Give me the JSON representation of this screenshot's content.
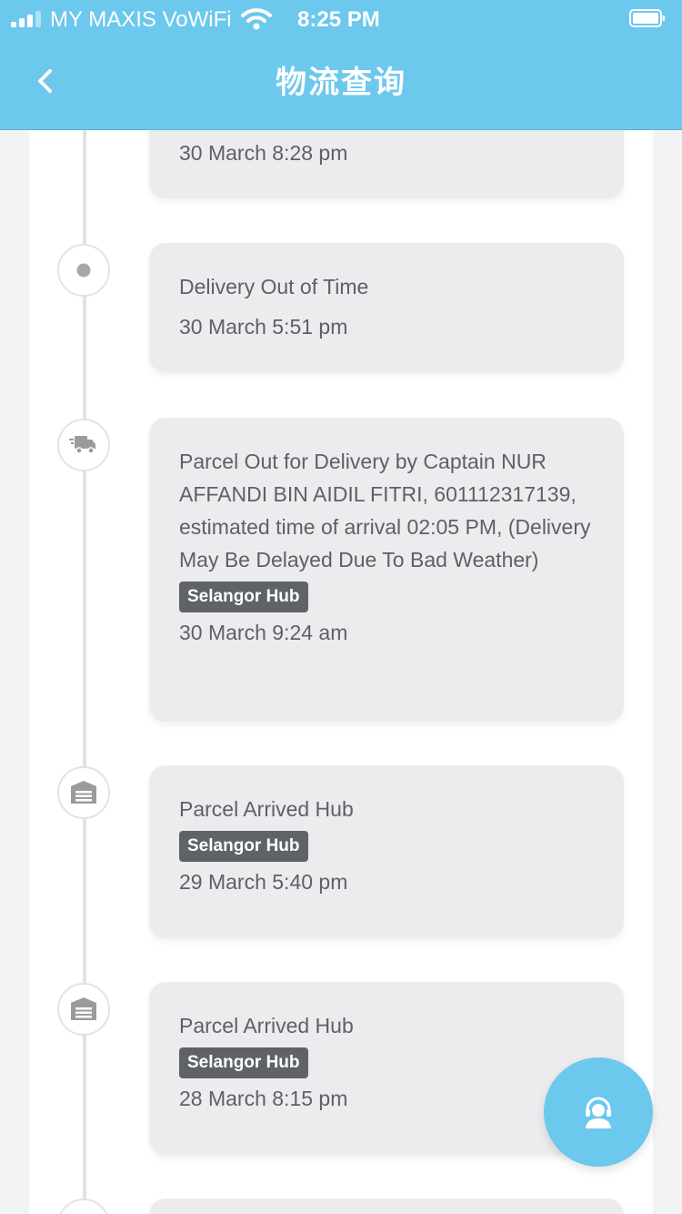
{
  "status_bar": {
    "carrier": "MY MAXIS VoWiFi",
    "time": "8:25 PM",
    "signal_icon": "cellular-signal-icon",
    "wifi_icon": "wifi-icon",
    "battery_icon": "battery-icon"
  },
  "nav": {
    "title": "物流查询",
    "back_icon": "chevron-left-icon"
  },
  "timeline": {
    "events": [
      {
        "icon": "partially-visible",
        "text": "",
        "hub": "",
        "time": "30 March 8:28 pm"
      },
      {
        "icon": "dot-icon",
        "text": "Delivery Out of Time",
        "hub": "",
        "time": "30 March 5:51 pm"
      },
      {
        "icon": "delivery-truck-icon",
        "text": "Parcel Out for Delivery by Captain NUR AFFANDI BIN AIDIL FITRI, 601112317139, estimated time of arrival 02:05 PM, (Delivery May Be Delayed Due To Bad Weather)",
        "hub": "Selangor Hub",
        "time": "30 March 9:24 am"
      },
      {
        "icon": "warehouse-icon",
        "text": "Parcel Arrived Hub",
        "hub": "Selangor Hub",
        "time": "29 March 5:40 pm"
      },
      {
        "icon": "warehouse-icon",
        "text": "Parcel Arrived Hub",
        "hub": "Selangor Hub",
        "time": "28 March 8:15 pm"
      }
    ]
  },
  "fab": {
    "icon": "customer-service-icon"
  },
  "colors": {
    "accent": "#6cc8ec",
    "card_bg": "#ececee",
    "badge_bg": "#5f6368",
    "text": "#5d6165"
  }
}
